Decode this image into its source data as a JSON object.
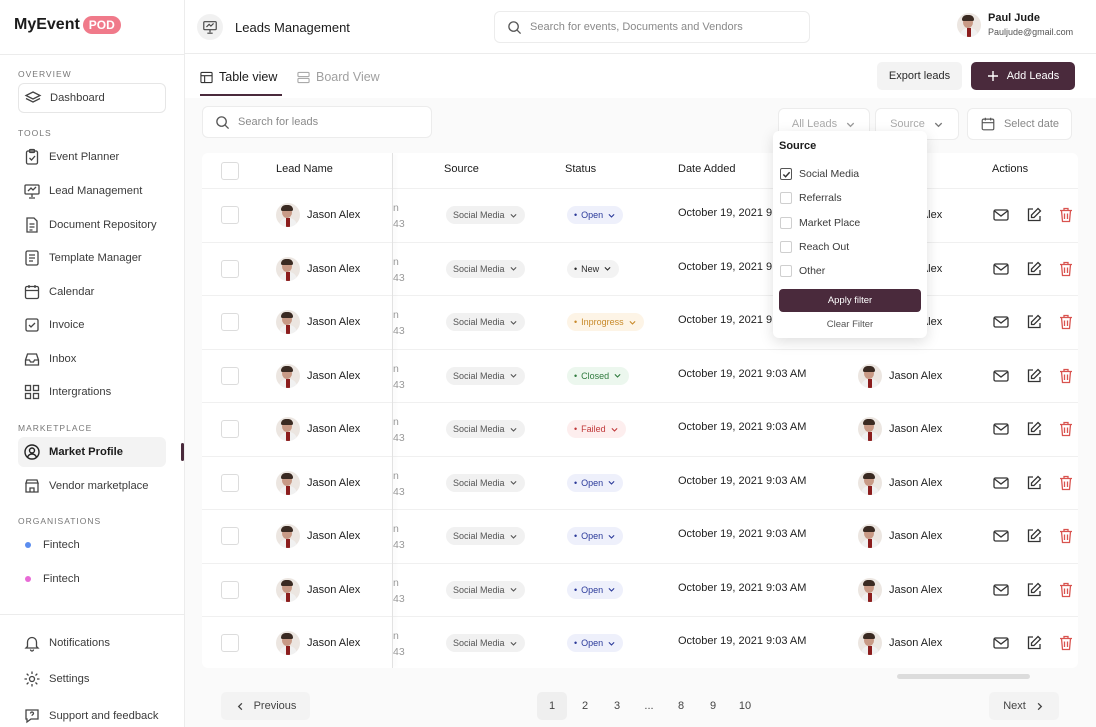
{
  "app": {
    "logo_text": "MyEvent",
    "logo_badge": "POD"
  },
  "sidebar": {
    "overview_label": "OVERVIEW",
    "dashboard": "Dashboard",
    "tools_label": "TOOLS",
    "tools": [
      "Event Planner",
      "Lead Management",
      "Document Repository",
      "Template Manager",
      "Calendar",
      "Invoice",
      "Inbox",
      "Intergrations"
    ],
    "marketplace_label": "MARKETPLACE",
    "marketplace": [
      "Market Profile",
      "Vendor marketplace"
    ],
    "organisations_label": "ORGANISATIONS",
    "organisations": [
      {
        "name": "Fintech",
        "color": "#5b8def"
      },
      {
        "name": "Fintech",
        "color": "#e86ad6"
      }
    ],
    "bottom": [
      "Notifications",
      "Settings",
      "Support and feedback"
    ]
  },
  "header": {
    "title": "Leads Management",
    "search_placeholder": "Search for events, Documents and Vendors",
    "user_name": "Paul Jude",
    "user_email": "Pauljude@gmail.com"
  },
  "toolbar": {
    "tab_table": "Table view",
    "tab_board": "Board View",
    "export_label": "Export leads",
    "add_label": "Add Leads",
    "lead_search_placeholder": "Search for leads",
    "filter_all": "All Leads",
    "filter_source": "Source",
    "filter_date": "Select date"
  },
  "table": {
    "headers": {
      "lead_name": "Lead Name",
      "source": "Source",
      "status": "Status",
      "date_added": "Date Added",
      "actions": "Actions"
    },
    "rows": [
      {
        "name": "Jason Alex",
        "frag_a": "n",
        "frag_b": "43",
        "source": "Social Media",
        "status": "Open",
        "status_kind": "open",
        "date": "October 19, 2021 9:03 AM",
        "owner": "Jason Alex"
      },
      {
        "name": "Jason Alex",
        "frag_a": "n",
        "frag_b": "43",
        "source": "Social Media",
        "status": "New",
        "status_kind": "new",
        "date": "October 19, 2021 9:03 AM",
        "owner": "Jason Alex"
      },
      {
        "name": "Jason Alex",
        "frag_a": "n",
        "frag_b": "43",
        "source": "Social Media",
        "status": "Inprogress",
        "status_kind": "inprogress",
        "date": "October 19, 2021 9:03 AM",
        "owner": "Jason Alex"
      },
      {
        "name": "Jason Alex",
        "frag_a": "n",
        "frag_b": "43",
        "source": "Social Media",
        "status": "Closed",
        "status_kind": "closed",
        "date": "October 19, 2021 9:03 AM",
        "owner": "Jason Alex"
      },
      {
        "name": "Jason Alex",
        "frag_a": "n",
        "frag_b": "43",
        "source": "Social Media",
        "status": "Failed",
        "status_kind": "failed",
        "date": "October 19, 2021 9:03 AM",
        "owner": "Jason Alex"
      },
      {
        "name": "Jason Alex",
        "frag_a": "n",
        "frag_b": "43",
        "source": "Social Media",
        "status": "Open",
        "status_kind": "open",
        "date": "October 19, 2021 9:03 AM",
        "owner": "Jason Alex"
      },
      {
        "name": "Jason Alex",
        "frag_a": "n",
        "frag_b": "43",
        "source": "Social Media",
        "status": "Open",
        "status_kind": "open",
        "date": "October 19, 2021 9:03 AM",
        "owner": "Jason Alex"
      },
      {
        "name": "Jason Alex",
        "frag_a": "n",
        "frag_b": "43",
        "source": "Social Media",
        "status": "Open",
        "status_kind": "open",
        "date": "October 19, 2021 9:03 AM",
        "owner": "Jason Alex"
      },
      {
        "name": "Jason Alex",
        "frag_a": "n",
        "frag_b": "43",
        "source": "Social Media",
        "status": "Open",
        "status_kind": "open",
        "date": "October 19, 2021 9:03 AM",
        "owner": "Jason Alex"
      }
    ]
  },
  "pagination": {
    "previous": "Previous",
    "next": "Next",
    "pages": [
      "1",
      "2",
      "3",
      "...",
      "8",
      "9",
      "10"
    ],
    "current": "1"
  },
  "source_dropdown": {
    "title": "Source",
    "options": [
      {
        "label": "Social Media",
        "checked": true
      },
      {
        "label": "Referrals",
        "checked": false
      },
      {
        "label": "Market Place",
        "checked": false
      },
      {
        "label": "Reach Out",
        "checked": false
      },
      {
        "label": "Other",
        "checked": false
      }
    ],
    "apply_label": "Apply filter",
    "clear_label": "Clear Filter"
  },
  "colors": {
    "accent": "#4a2a3c",
    "danger": "#d9534f",
    "badge": "#f07a8a"
  }
}
